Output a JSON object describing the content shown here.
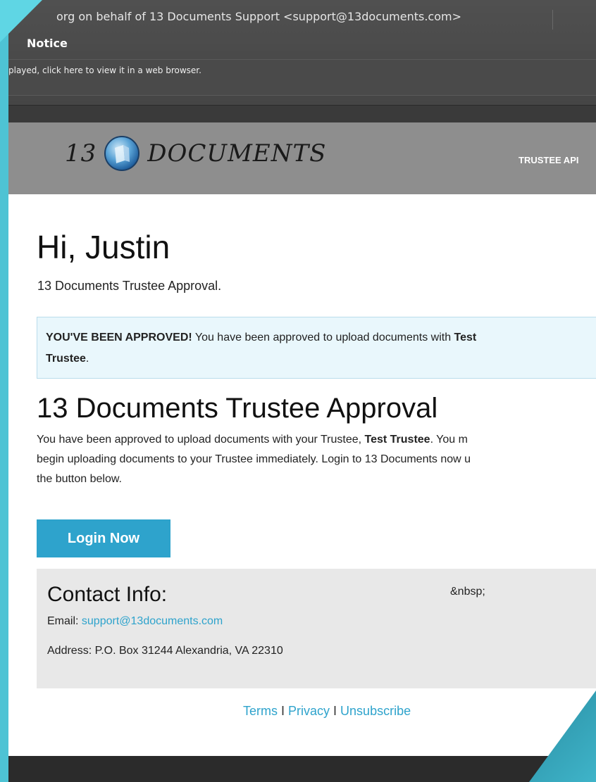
{
  "header": {
    "from_text": "org on behalf of 13 Documents Support <support@13documents.com>",
    "subject": "Notice",
    "info_bar": "played, click here to view it in a web browser."
  },
  "brand": {
    "left_text": "13",
    "right_text": "DOCUMENTS",
    "nav_text": "TRUSTEE API"
  },
  "greeting": {
    "title": "Hi, Justin",
    "subtitle": "13 Documents Trustee Approval."
  },
  "alert": {
    "headline": "YOU'VE BEEN APPROVED!",
    "text": " You have been approved to upload documents with ",
    "bold_1": "Test",
    "bold_2": "Trustee",
    "tail": "."
  },
  "section": {
    "title": "13 Documents Trustee Approval",
    "line1_prefix": "You have been approved to upload documents with your Trustee, ",
    "line1_bold": "Test Trustee",
    "line1_suffix": ". You m",
    "line2": "begin uploading documents to your Trustee immediately. Login to 13 Documents now u",
    "line3": "the button below."
  },
  "login_button": "Login Now",
  "contact": {
    "title": "Contact Info:",
    "nbsp": "&nbsp;",
    "email_label": "Email: ",
    "email": "support@13documents.com",
    "address": "Address: P.O. Box 31244 Alexandria, VA 22310"
  },
  "footer": {
    "terms": "Terms",
    "separator": " I ",
    "privacy": "Privacy",
    "unsubscribe": "Unsubscribe"
  },
  "colors": {
    "accent": "#2ea3cc",
    "brand_bar": "#8e8e8e",
    "alert_bg": "#e9f7fc",
    "contact_bg": "#e8e8e8"
  }
}
